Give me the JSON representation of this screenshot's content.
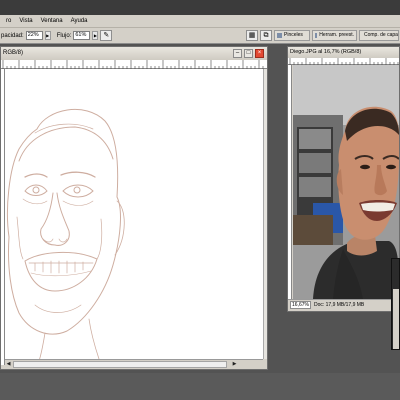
{
  "menubar": {
    "items": [
      "ro",
      "Vista",
      "Ventana",
      "Ayuda"
    ]
  },
  "options": {
    "opacity_label": "pacidad:",
    "opacity_value": "22%",
    "flow_label": "Flujo:",
    "flow_value": "61%",
    "palette_tabs": [
      "Pinceles",
      "Herram. preest.",
      "Comp. de capas"
    ]
  },
  "doc_window": {
    "title": "RGB/8)"
  },
  "photo_window": {
    "title": "Diego.JPG al 16,7% (RGB/8)",
    "zoom": "16,67%",
    "doc_size": "Doc: 17,9 MB/17,9 MB"
  },
  "colors": {
    "sketch_stroke": "#c9a596",
    "ui_gray": "#d4d0c8",
    "workspace": "#535353",
    "close_red": "#e34a33"
  }
}
